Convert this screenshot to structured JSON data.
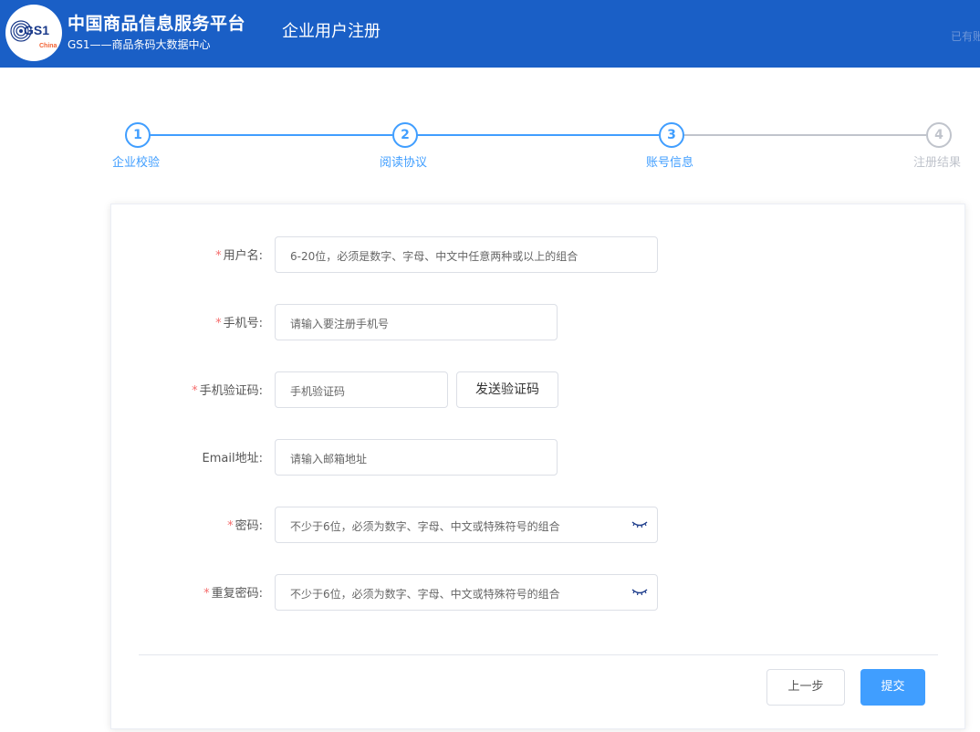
{
  "header": {
    "brand_title": "中国商品信息服务平台",
    "brand_subtitle": "GS1——商品条码大数据中心",
    "logo_text": "GS1",
    "logo_subtext": "China",
    "page_title": "企业用户注册",
    "right_link": "已有账号"
  },
  "steps": [
    {
      "number": "1",
      "label": "企业校验",
      "status": "done"
    },
    {
      "number": "2",
      "label": "阅读协议",
      "status": "done"
    },
    {
      "number": "3",
      "label": "账号信息",
      "status": "current"
    },
    {
      "number": "4",
      "label": "注册结果",
      "status": "pending"
    }
  ],
  "form": {
    "required_mark": "*",
    "username": {
      "label": "用户名:",
      "placeholder": "6-20位，必须是数字、字母、中文中任意两种或以上的组合"
    },
    "phone": {
      "label": "手机号:",
      "placeholder": "请输入要注册手机号"
    },
    "sms_code": {
      "label": "手机验证码:",
      "placeholder": "手机验证码",
      "send_button": "发送验证码"
    },
    "email": {
      "label": "Email地址:",
      "placeholder": "请输入邮箱地址"
    },
    "password": {
      "label": "密码:",
      "placeholder": "不少于6位，必须为数字、字母、中文或特殊符号的组合",
      "icon": "eye-closed-icon"
    },
    "password_repeat": {
      "label": "重复密码:",
      "placeholder": "不少于6位，必须为数字、字母、中文或特殊符号的组合",
      "icon": "eye-closed-icon"
    }
  },
  "actions": {
    "prev_label": "上一步",
    "submit_label": "提交"
  },
  "colors": {
    "header_bg": "#1a5fc6",
    "accent": "#409eff",
    "inactive": "#c0c4cc",
    "required": "#f56c6c"
  }
}
